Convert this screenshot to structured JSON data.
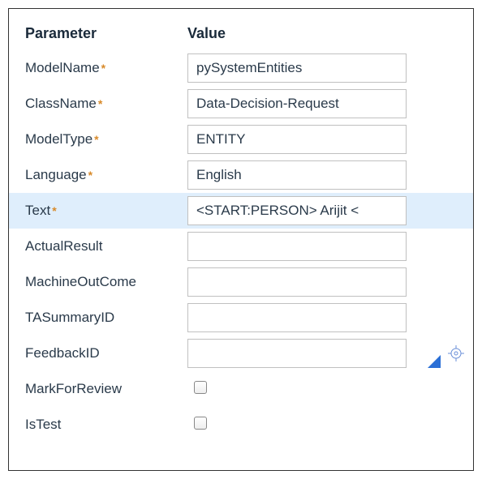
{
  "headers": {
    "parameter": "Parameter",
    "value": "Value"
  },
  "rows": [
    {
      "label": "ModelName",
      "required": true,
      "type": "text",
      "value": "pySystemEntities",
      "highlight": false
    },
    {
      "label": "ClassName",
      "required": true,
      "type": "text",
      "value": "Data-Decision-Request",
      "highlight": false
    },
    {
      "label": "ModelType",
      "required": true,
      "type": "text",
      "value": "ENTITY",
      "highlight": false
    },
    {
      "label": "Language",
      "required": true,
      "type": "text",
      "value": "English",
      "highlight": false
    },
    {
      "label": "Text",
      "required": true,
      "type": "text",
      "value": "<START:PERSON> Arijit <",
      "highlight": true
    },
    {
      "label": "ActualResult",
      "required": false,
      "type": "text",
      "value": "",
      "highlight": false
    },
    {
      "label": "MachineOutCome",
      "required": false,
      "type": "text",
      "value": "",
      "highlight": false
    },
    {
      "label": "TASummaryID",
      "required": false,
      "type": "text",
      "value": "",
      "highlight": false
    },
    {
      "label": "FeedbackID",
      "required": false,
      "type": "text",
      "value": "",
      "highlight": false,
      "corner": true,
      "target": true
    },
    {
      "label": "MarkForReview",
      "required": false,
      "type": "checkbox",
      "checked": false,
      "highlight": false
    },
    {
      "label": "IsTest",
      "required": false,
      "type": "checkbox",
      "checked": false,
      "highlight": false
    }
  ],
  "required_marker": "*"
}
